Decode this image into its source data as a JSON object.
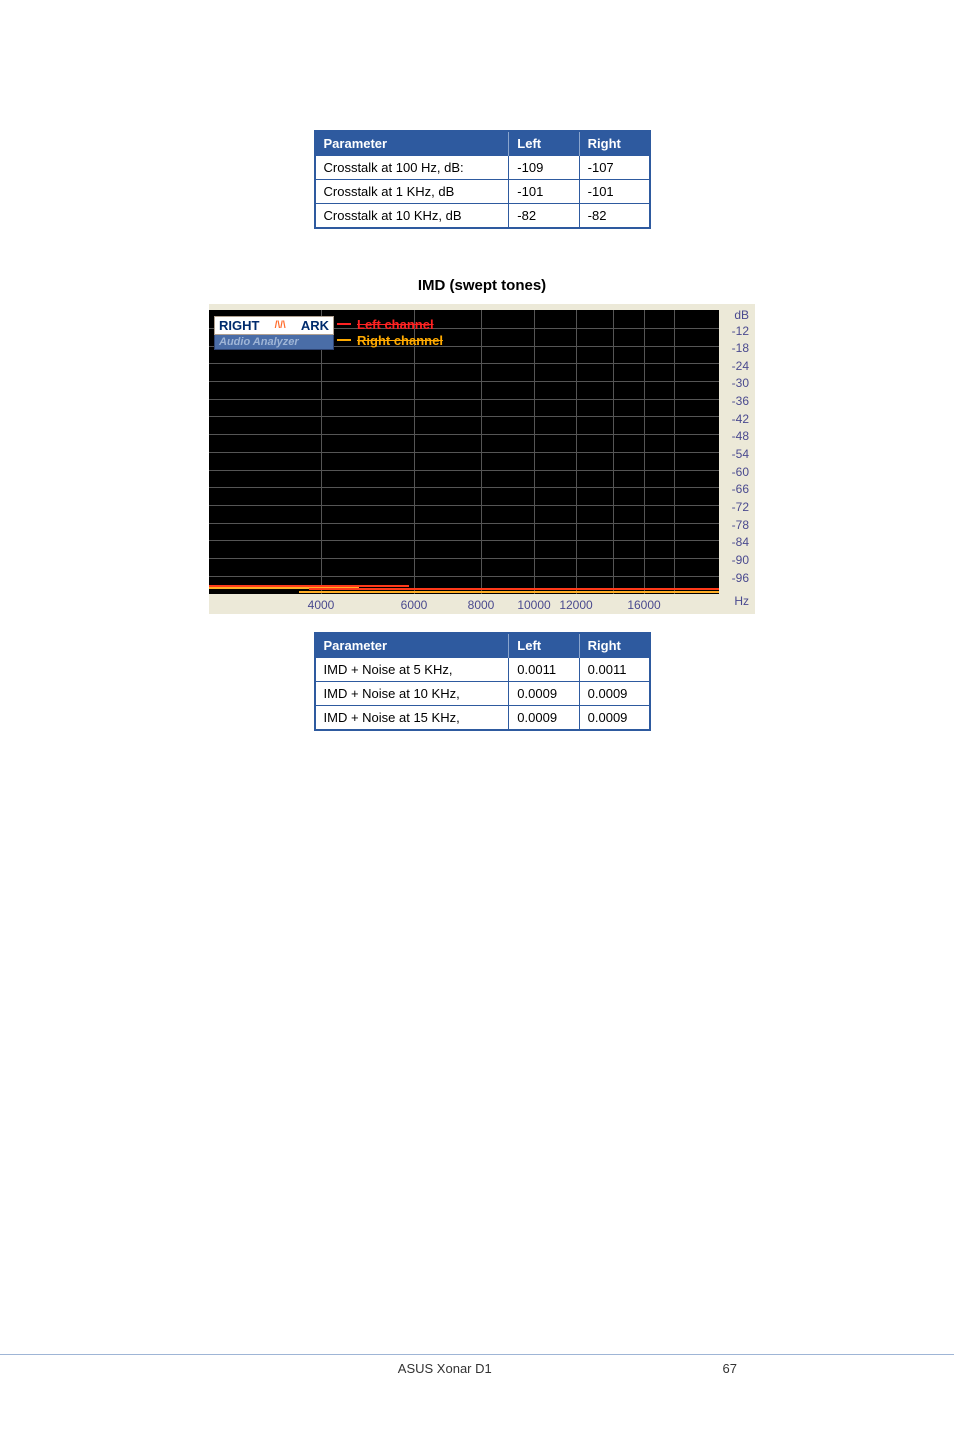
{
  "table1": {
    "headers": [
      "Parameter",
      "Left",
      "Right"
    ],
    "rows": [
      {
        "p": "Crosstalk at 100 Hz, dB:",
        "l": "-109",
        "r": "-107"
      },
      {
        "p": "Crosstalk at 1 KHz, dB",
        "l": "-101",
        "r": "-101"
      },
      {
        "p": "Crosstalk at 10 KHz, dB",
        "l": "-82",
        "r": "-82"
      }
    ]
  },
  "chart_title": "IMD (swept tones)",
  "chart_data": {
    "type": "line",
    "title": "IMD (swept tones)",
    "xlabel": "Hz",
    "ylabel": "dB",
    "ylim": [
      -96,
      0
    ],
    "x_ticks": [
      4000,
      6000,
      8000,
      10000,
      12000,
      16000
    ],
    "y_ticks": [
      "dB",
      -12,
      -18,
      -24,
      -30,
      -36,
      -42,
      -48,
      -54,
      -60,
      -66,
      -72,
      -78,
      -84,
      -90,
      -96
    ],
    "series": [
      {
        "name": "Left channel",
        "approx_range_db": [
          -98,
          -94
        ]
      },
      {
        "name": "Right channel",
        "approx_range_db": [
          -98,
          -94
        ]
      }
    ]
  },
  "legend": {
    "logo_left": "RIGHT",
    "logo_right": "ARK",
    "logo_sub": "Audio Analyzer",
    "left_channel": "Left channel",
    "right_channel": "Right channel"
  },
  "table2": {
    "headers": [
      "Parameter",
      "Left",
      "Right"
    ],
    "rows": [
      {
        "p": "IMD + Noise at 5 KHz,",
        "l": "0.0011",
        "r": "0.0011"
      },
      {
        "p": "IMD + Noise at 10 KHz,",
        "l": "0.0009",
        "r": "0.0009"
      },
      {
        "p": "IMD + Noise at 15 KHz,",
        "l": "0.0009",
        "r": "0.0009"
      }
    ]
  },
  "footer": {
    "product": "ASUS Xonar D1",
    "page": "67"
  },
  "axis": {
    "db": "dB",
    "hz": "Hz"
  }
}
